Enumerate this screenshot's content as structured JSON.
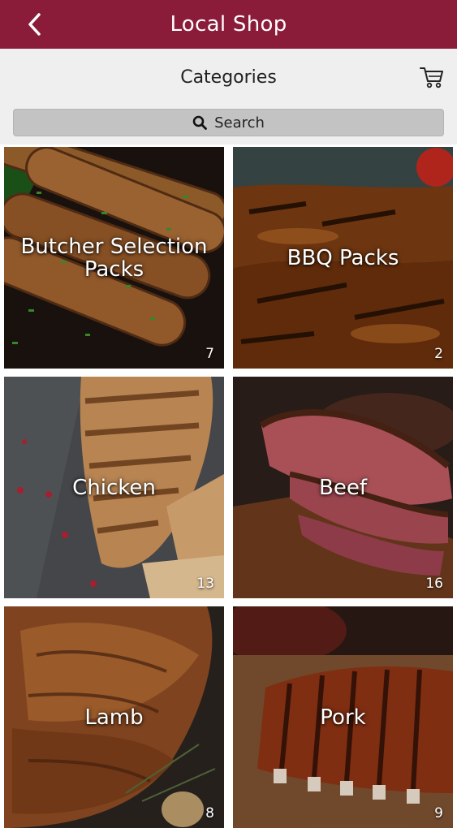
{
  "header": {
    "title": "Local Shop",
    "back_icon": "chevron-left-icon",
    "bar_color": "#8a1c3a"
  },
  "subheader": {
    "title": "Categories",
    "cart_icon": "shopping-cart-icon"
  },
  "search": {
    "label": "Search",
    "icon": "search-icon"
  },
  "categories": [
    {
      "name": "Butcher Selection\nPacks",
      "count": "7"
    },
    {
      "name": "BBQ Packs",
      "count": "2"
    },
    {
      "name": "Chicken",
      "count": "13"
    },
    {
      "name": "Beef",
      "count": "16"
    },
    {
      "name": "Lamb",
      "count": "8"
    },
    {
      "name": "Pork",
      "count": "9"
    }
  ]
}
